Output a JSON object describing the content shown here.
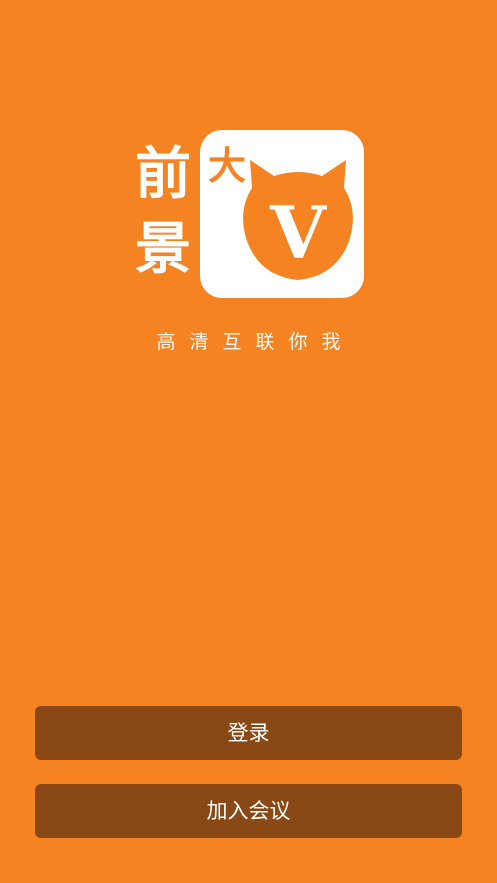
{
  "brand": {
    "char_top": "前",
    "char_bottom": "景",
    "box_char": "大",
    "box_letter": "V",
    "tagline": "高清互联你我"
  },
  "buttons": {
    "login": "登录",
    "join_meeting": "加入会议"
  },
  "colors": {
    "background": "#F58322",
    "button": "#8A4814",
    "logo_box": "#FFFFFF",
    "accent": "#F58322"
  }
}
